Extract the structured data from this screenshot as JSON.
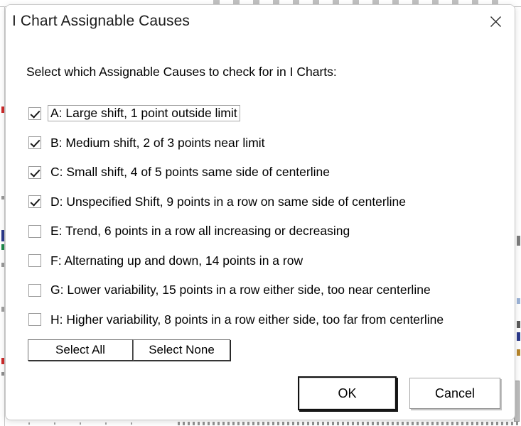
{
  "dialog": {
    "title": "I Chart Assignable Causes",
    "close_icon": "close-icon",
    "instruction": "Select which Assignable Causes to check for in I Charts:",
    "causes": [
      {
        "id": "A",
        "label": "A: Large shift, 1 point outside limit",
        "checked": true,
        "focused": true
      },
      {
        "id": "B",
        "label": "B: Medium shift, 2 of 3 points near limit",
        "checked": true,
        "focused": false
      },
      {
        "id": "C",
        "label": "C: Small shift, 4 of 5 points same side of centerline",
        "checked": true,
        "focused": false
      },
      {
        "id": "D",
        "label": "D: Unspecified Shift, 9 points in a row on same side of centerline",
        "checked": true,
        "focused": false
      },
      {
        "id": "E",
        "label": "E: Trend, 6 points in a row all increasing or decreasing",
        "checked": false,
        "focused": false
      },
      {
        "id": "F",
        "label": "F: Alternating up and down, 14 points in a row",
        "checked": false,
        "focused": false
      },
      {
        "id": "G",
        "label": "G: Lower variability, 15 points in a row either side, too near centerline",
        "checked": false,
        "focused": false
      },
      {
        "id": "H",
        "label": "H: Higher variability, 8 points in a row either side, too far from centerline",
        "checked": false,
        "focused": false
      }
    ],
    "buttons": {
      "select_all": "Select All",
      "select_none": "Select None",
      "ok": "OK",
      "cancel": "Cancel"
    }
  }
}
